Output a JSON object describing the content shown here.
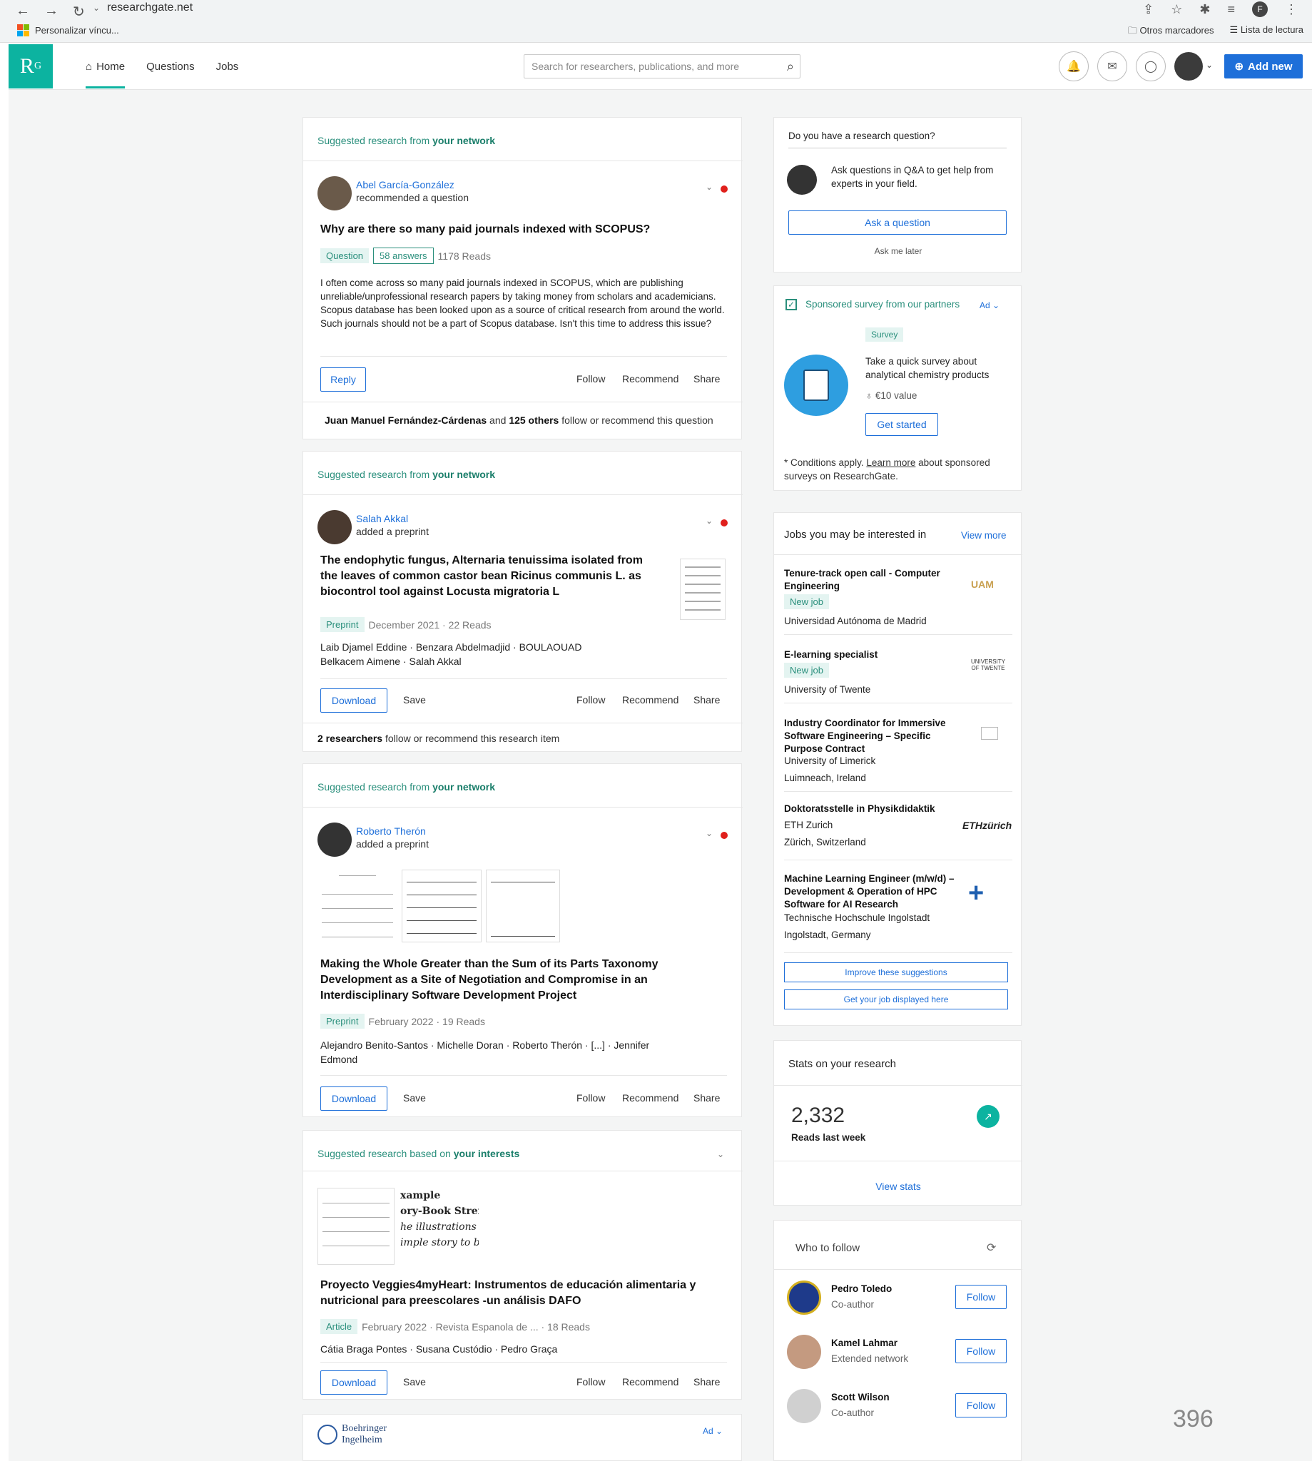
{
  "browser": {
    "url": "researchgate.net",
    "bookmark_left": "Personalizar víncu...",
    "bookmark_others": "Otros marcadores",
    "bookmark_reading": "Lista de lectura",
    "profile_initial": "F"
  },
  "header": {
    "logo": "R",
    "logo_sup": "G",
    "nav": {
      "home": "Home",
      "questions": "Questions",
      "jobs": "Jobs"
    },
    "search_placeholder": "Search for researchers, publications, and more",
    "add_new": "Add new"
  },
  "feed": {
    "card1": {
      "sugg_prefix": "Suggested research from ",
      "sugg_bold": "your network",
      "user": "Abel García-González",
      "action": "recommended a question",
      "title": "Why are there so many paid journals indexed with SCOPUS?",
      "tag": "Question",
      "answers": "58 answers",
      "reads": "1178 Reads",
      "body": "I often come across so many paid journals indexed in SCOPUS, which are publishing unreliable/unprofessional research papers by taking money from scholars and academicians. Scopus database has been looked upon as a source of critical research from around the world. Such journals should not be a part of Scopus database. Isn't this time to address this issue?",
      "reply": "Reply",
      "follow": "Follow",
      "recommend": "Recommend",
      "share": "Share",
      "footer_name": "Juan Manuel Fernández-Cárdenas",
      "footer_and": " and ",
      "footer_count": "125 others",
      "footer_rest": " follow or recommend this question"
    },
    "card2": {
      "sugg_prefix": "Suggested research from ",
      "sugg_bold": "your network",
      "user": "Salah Akkal",
      "action": "added a preprint",
      "title": "The endophytic fungus, Alternaria tenuissima isolated from the leaves of common castor bean Ricinus communis L. as biocontrol tool against Locusta migratoria L",
      "tag": "Preprint",
      "meta": "December 2021 · 22 Reads",
      "authors_line1": "Laib Djamel Eddine ·   Benzara Abdelmadjid ·   BOULAOUAD",
      "authors_line2": "Belkacem Aimene ·   Salah Akkal",
      "download": "Download",
      "save": "Save",
      "follow": "Follow",
      "recommend": "Recommend",
      "share": "Share",
      "footer_bold": "2 researchers",
      "footer_rest": " follow or recommend this research item"
    },
    "card3": {
      "sugg_prefix": "Suggested research from ",
      "sugg_bold": "your network",
      "user": "Roberto Therón",
      "action": "added a preprint",
      "title": "Making the Whole Greater than the Sum of its Parts Taxonomy Development as a Site of Negotiation and Compromise in an Interdisciplinary Software Development Project",
      "tag": "Preprint",
      "meta": "February 2022 · 19 Reads",
      "authors_line1": "Alejandro Benito-Santos ·   Michelle Doran ·   Roberto Therón · [...] ·   Jennifer",
      "authors_line2": "Edmond",
      "download": "Download",
      "save": "Save",
      "follow": "Follow",
      "recommend": "Recommend",
      "share": "Share"
    },
    "card4": {
      "sugg_prefix": "Suggested research based on ",
      "sugg_bold": "your interests",
      "thumb_text1": "xample",
      "thumb_text2": "ory-Book Stren",
      "thumb_text3": "he illustrations",
      "thumb_text4": "imple story to b",
      "title": "Proyecto Veggies4myHeart: Instrumentos de educación alimentaria y nutricional para preescolares -un análisis DAFO",
      "tag": "Article",
      "meta": "February 2022 · Revista Espanola de ...  · 18 Reads",
      "authors": "Cátia Braga Pontes ·   Susana Custódio ·   Pedro Graça",
      "download": "Download",
      "save": "Save",
      "follow": "Follow",
      "recommend": "Recommend",
      "share": "Share"
    },
    "ad": {
      "brand1": "Boehringer",
      "brand2": "Ingelheim",
      "label": "Ad"
    }
  },
  "sidebar": {
    "question": {
      "heading": "Do you have a research question?",
      "text": "Ask questions in Q&A to get help from experts in your field.",
      "button": "Ask a question",
      "later": "Ask me later"
    },
    "survey": {
      "heading": "Sponsored survey from our partners",
      "ad": "Ad",
      "tag": "Survey",
      "text": "Take a quick survey about analytical chemistry products",
      "value": "€10 value",
      "button": "Get started",
      "cond_pre": "* Conditions apply. ",
      "cond_link": "Learn more",
      "cond_post": " about sponsored surveys on ResearchGate."
    },
    "jobs": {
      "heading": "Jobs you may be interested in",
      "view_more": "View more",
      "items": [
        {
          "title": "Tenure-track open call - Computer Engineering",
          "badge": "New job",
          "org": "Universidad Autónoma de Madrid",
          "loc": "",
          "logo": "UAM"
        },
        {
          "title": "E-learning specialist",
          "badge": "New job",
          "org": "University of Twente",
          "loc": "",
          "logo": "UNIVERSITY OF TWENTE"
        },
        {
          "title": "Industry Coordinator for Immersive Software Engineering – Specific Purpose Contract",
          "badge": "",
          "org": "University of Limerick",
          "loc": "Luimneach, Ireland",
          "logo": ""
        },
        {
          "title": "Doktoratsstelle in Physikdidaktik",
          "badge": "",
          "org": "ETH Zurich",
          "loc": "Zürich, Switzerland",
          "logo": "ETHzürich"
        },
        {
          "title": "Machine Learning Engineer (m/w/d) – Development & Operation of HPC Software for AI Research",
          "badge": "",
          "org": "Technische Hochschule Ingolstadt",
          "loc": "Ingolstadt, Germany",
          "logo": ""
        }
      ],
      "improve": "Improve these suggestions",
      "display": "Get your job displayed here"
    },
    "stats": {
      "heading": "Stats on your research",
      "value": "2,332",
      "label": "Reads last week",
      "link": "View stats"
    },
    "follow": {
      "heading": "Who to follow",
      "people": [
        {
          "name": "Pedro Toledo",
          "rel": "Co-author",
          "btn": "Follow"
        },
        {
          "name": "Kamel Lahmar",
          "rel": "Extended network",
          "btn": "Follow"
        },
        {
          "name": "Scott Wilson",
          "rel": "Co-author",
          "btn": "Follow"
        }
      ]
    }
  },
  "page_number": "396"
}
